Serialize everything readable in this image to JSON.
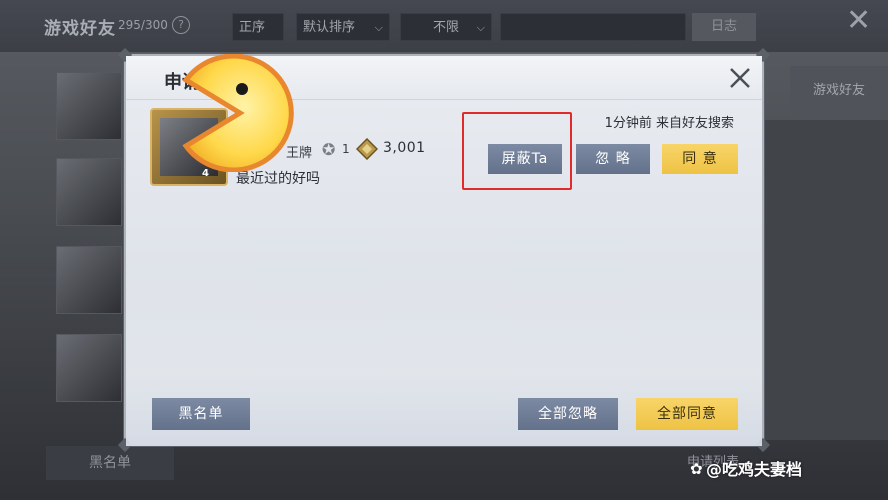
{
  "background": {
    "title": "游戏好友",
    "friend_count": "295/300",
    "help_icon": "help-circle-icon",
    "sort_dropdown_1": "正序",
    "sort_dropdown_2": "默认排序",
    "filter_dropdown": "不限",
    "dim_button": "日志",
    "blacklist_tab": "黑名单",
    "right_tab": "游戏好友",
    "apply_list_tab": "申请列表"
  },
  "dialog": {
    "title": "申请",
    "close_icon": "close-x-icon",
    "request": {
      "rank_label": "王牌",
      "rank_level": "1",
      "score": "3,001",
      "avatar_level": "4",
      "message": "最近过的好吗",
      "meta": "1分钟前 来自好友搜索",
      "block_label": "屏蔽Ta",
      "ignore_label": "忽 略",
      "accept_label": "同 意"
    },
    "footer": {
      "blacklist_label": "黑名单",
      "ignore_all_label": "全部忽略",
      "accept_all_label": "全部同意"
    }
  },
  "overlay": {
    "watermark": "@吃鸡夫妻档"
  },
  "colors": {
    "accent_yellow": "#eec244",
    "button_gray": "#6f7c95",
    "highlight_red": "#e12a2a"
  }
}
